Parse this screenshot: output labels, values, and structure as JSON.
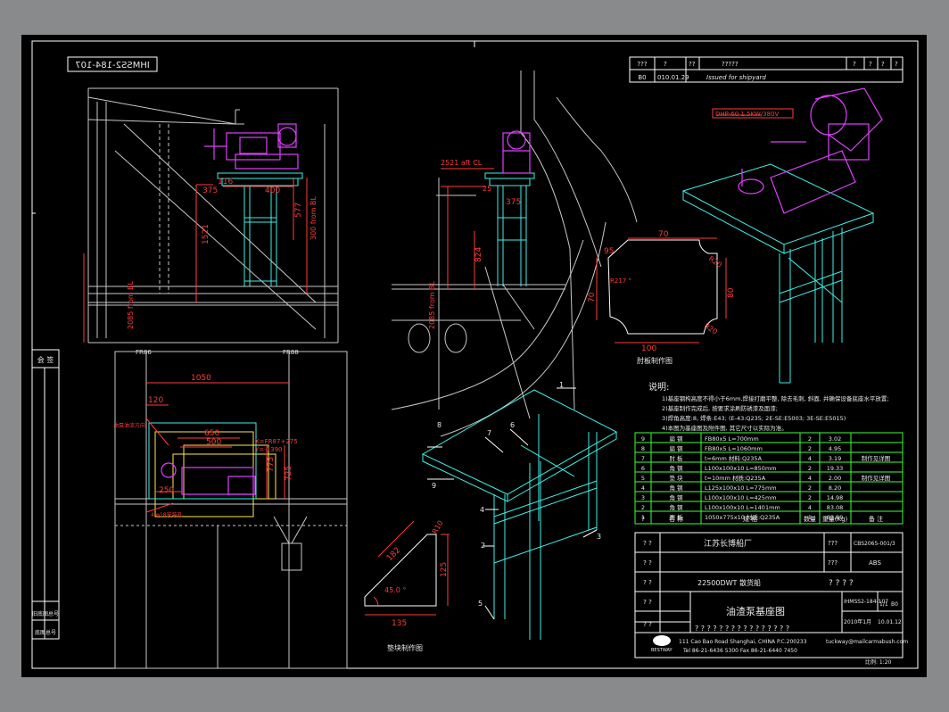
{
  "colors": {
    "background": "#000000",
    "frame": "#ffffff",
    "dimension": "#ff3b3b",
    "structure": "#3df0e6",
    "equipment": "#e040ff",
    "notes": "#ffffff",
    "table_lines": "#3cff3c",
    "hull": "#c8c8c8"
  },
  "drawing_no_mirrored": "IHMSS2-184-107",
  "revision": {
    "header": [
      "???",
      "?",
      "??",
      "?????",
      "?",
      "?",
      "?",
      "?"
    ],
    "row": {
      "rev": "B0",
      "date": "010.01.29",
      "desc": "Issued for shipyard"
    }
  },
  "views": {
    "side_view": {
      "dims": {
        "d116": "116",
        "d375": "375",
        "d400": "400",
        "d1521": "1521",
        "d577": "577",
        "d300": "300 from BL",
        "d2085": "2085 from BL"
      }
    },
    "section_view": {
      "dims": {
        "d2521": "2521 aft CL",
        "d375": "375",
        "d824": "824",
        "d2085": "2085 from BL",
        "d25": "25"
      }
    },
    "plan_view": {
      "labels": {
        "fr_left": "FR86",
        "fr_right": "FR88"
      },
      "dims": {
        "d1050": "1050",
        "d120": "120",
        "d650": "650",
        "d500": "500",
        "d250": "250",
        "x_coord": "X=FR87+275",
        "y_coord": "Y=-1390",
        "d775": "775",
        "d725": "725"
      },
      "notes": {
        "n1": "油泵油流方向",
        "n2": "4-φ18安装孔"
      }
    },
    "plate_detail": {
      "dims": {
        "d70": "70",
        "d95": "95",
        "d820": "R20",
        "d80": "80",
        "d70b": "70",
        "d100": "100",
        "r217": "R217 °",
        "d120": "R20"
      },
      "caption": "肘板制作图"
    },
    "gusset_detail": {
      "dims": {
        "d182": "182",
        "d125": "125",
        "d135": "135",
        "d90": "R10",
        "angle": "45.0 °"
      },
      "caption": "垫块制作图"
    },
    "iso_numbers": [
      "1",
      "2",
      "3",
      "4",
      "5",
      "6",
      "7",
      "8",
      "9"
    ],
    "callout": "DHP-60 1.5KW/380V"
  },
  "notes": {
    "title": "说明:",
    "lines": [
      "1)基座钢构高度不得小于6mm,焊接打磨平整, 除去毛刺, 斜面, 并确保设备底座水平放置;",
      "2)基座制作完成后, 按要求涂刷防锈漆及面漆;",
      "3)焊角高度:8, 焊条:E43; (E-43:Q235; 2E-SE:E5003; 3E-SE:E5015)",
      "4)本图为基座图及附件图, 其它尺寸以实际为准。"
    ]
  },
  "bom": {
    "header": [
      "序",
      "名 称",
      "规 格",
      "数量",
      "重量(Kg)",
      "备 注"
    ],
    "header_visible": [
      "?",
      "名 称",
      "规 格",
      "数量",
      "重量(Kg)",
      "备 注"
    ],
    "rows": [
      {
        "no": "9",
        "name": "扁 钢",
        "spec": "FB80x5 L=700mm",
        "qty": "2",
        "wt": "3.02",
        "note": ""
      },
      {
        "no": "8",
        "name": "扁 钢",
        "spec": "FB80x5 L=1060mm",
        "qty": "2",
        "wt": "4.95",
        "note": ""
      },
      {
        "no": "7",
        "name": "肘 板",
        "spec": "t=6mm 材料:Q235A",
        "qty": "4",
        "wt": "3.19",
        "note": "制作见详图"
      },
      {
        "no": "6",
        "name": "角 钢",
        "spec": "L100x100x10 L=850mm",
        "qty": "2",
        "wt": "19.33",
        "note": ""
      },
      {
        "no": "5",
        "name": "垫 块",
        "spec": "t=10mm 材质:Q235A",
        "qty": "4",
        "wt": "2.00",
        "note": "制作见详图"
      },
      {
        "no": "4",
        "name": "角 钢",
        "spec": "L125x100x10 L=775mm",
        "qty": "2",
        "wt": "8.20",
        "note": ""
      },
      {
        "no": "3",
        "name": "角 钢",
        "spec": "L100x100x10 L=425mm",
        "qty": "2",
        "wt": "14.98",
        "note": ""
      },
      {
        "no": "2",
        "name": "角 钢",
        "spec": "L100x100x10 L=1401mm",
        "qty": "4",
        "wt": "83.08",
        "note": ""
      },
      {
        "no": "1",
        "name": "面 板",
        "spec": "1050x775x10 材质:Q235A",
        "qty": "1",
        "wt": "63.89",
        "note": ""
      }
    ]
  },
  "title_block": {
    "q1": "? ?",
    "q2": "? ?",
    "q3": "? ?",
    "q4": "? ?",
    "q5": "? ?",
    "yard": "江苏长博船厂",
    "qq1": "???",
    "qq2": "???",
    "code": "CBS2065-001/3",
    "class": "ABS",
    "ship": "22500DWT 散货船",
    "qmarks": "? ? ? ?",
    "title": "油渣泵基座图",
    "dwg": "IHMSS2-184-107",
    "sheet1": "1/1",
    "ver": "B0",
    "date": "2010年1月",
    "date2": "10.01.12",
    "long_q": "? ? ? ? ? ? ? ? ? ? ? ? ? ? ? ?",
    "company_logo": "BESTWAY",
    "address": "111 Cao Bao Road Shanghai, CHINA   P.C.200233",
    "tel": "Tel 86-21-6436 5300   Fax 86-21-6440 7450",
    "email": "tuckway@mailcarmabush.com",
    "scale": "比例: 1:20"
  },
  "left_strip": {
    "label1": "会 签",
    "label2": "旧底图总号",
    "label3": "底图总号"
  }
}
